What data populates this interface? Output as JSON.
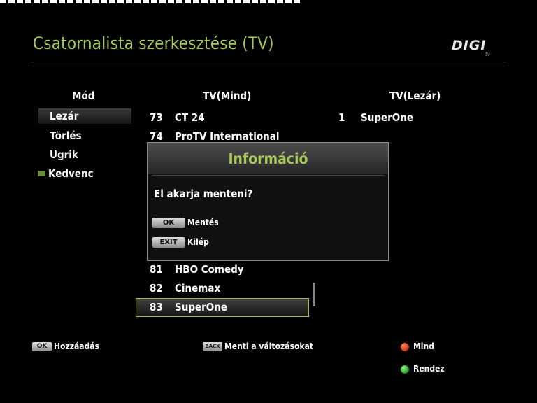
{
  "header": {
    "title": "Csatornalista szerkesztése (TV)",
    "logo_text": "DIGI",
    "logo_sub": "tv"
  },
  "columns": {
    "mode": "Mód",
    "all": "TV(Mind)",
    "locked": "TV(Lezár)"
  },
  "modes": [
    {
      "label": "Lezár",
      "active": true
    },
    {
      "label": "Törlés"
    },
    {
      "label": "Ugrik"
    },
    {
      "label": "Kedvenc",
      "icon": "folder-icon"
    }
  ],
  "all_channels": [
    {
      "num": "73",
      "name": "CT 24"
    },
    {
      "num": "74",
      "name": "ProTV International"
    },
    {
      "num": "81",
      "name": "HBO Comedy"
    },
    {
      "num": "82",
      "name": "Cinemax"
    },
    {
      "num": "83",
      "name": "SuperOne",
      "selected": true
    }
  ],
  "locked_channels": [
    {
      "num": "1",
      "name": "SuperOne"
    }
  ],
  "dialog": {
    "title": "Információ",
    "message": "El akarja menteni?",
    "options": [
      {
        "key": "OK",
        "label": "Mentés"
      },
      {
        "key": "EXIT",
        "label": "Kilép"
      }
    ]
  },
  "footer": {
    "add": {
      "key": "OK",
      "label": "Hozzáadás"
    },
    "save": {
      "key": "BACK",
      "label": "Menti a változásokat"
    },
    "red": {
      "label": "Mind",
      "color": "#d83a1a"
    },
    "green": {
      "label": "Rendez",
      "color": "#2aa52a"
    }
  }
}
